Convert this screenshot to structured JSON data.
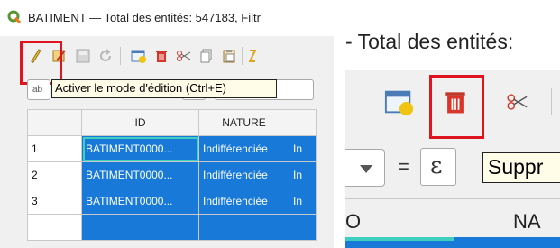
{
  "left": {
    "window_title": "BATIMENT — Total des entités: 547183, Filtr",
    "tooltip": "Activer le mode d'édition (Ctrl+E)",
    "filter_field_value": "ab",
    "columns": [
      "ID",
      "NATURE"
    ],
    "rows": [
      {
        "num": "1",
        "id": "BATIMENT0000...",
        "nature": "Indifférenciée",
        "next": "In"
      },
      {
        "num": "2",
        "id": "BATIMENT0000...",
        "nature": "Indifférenciée",
        "next": "In"
      },
      {
        "num": "3",
        "id": "BATIMENT0000...",
        "nature": "Indifférenciée",
        "next": "In"
      }
    ]
  },
  "right": {
    "window_title": "- Total des entités:",
    "tooltip": "Suppr",
    "operator": "=",
    "expression_symbol": "ε",
    "column_partial_left": "O",
    "column_partial_right": "NA"
  },
  "colors": {
    "highlight_box": "#e0141e",
    "selection": "#1879d8",
    "tooltip_bg": "#fffde7",
    "current_cell": "#3ecfc0"
  }
}
